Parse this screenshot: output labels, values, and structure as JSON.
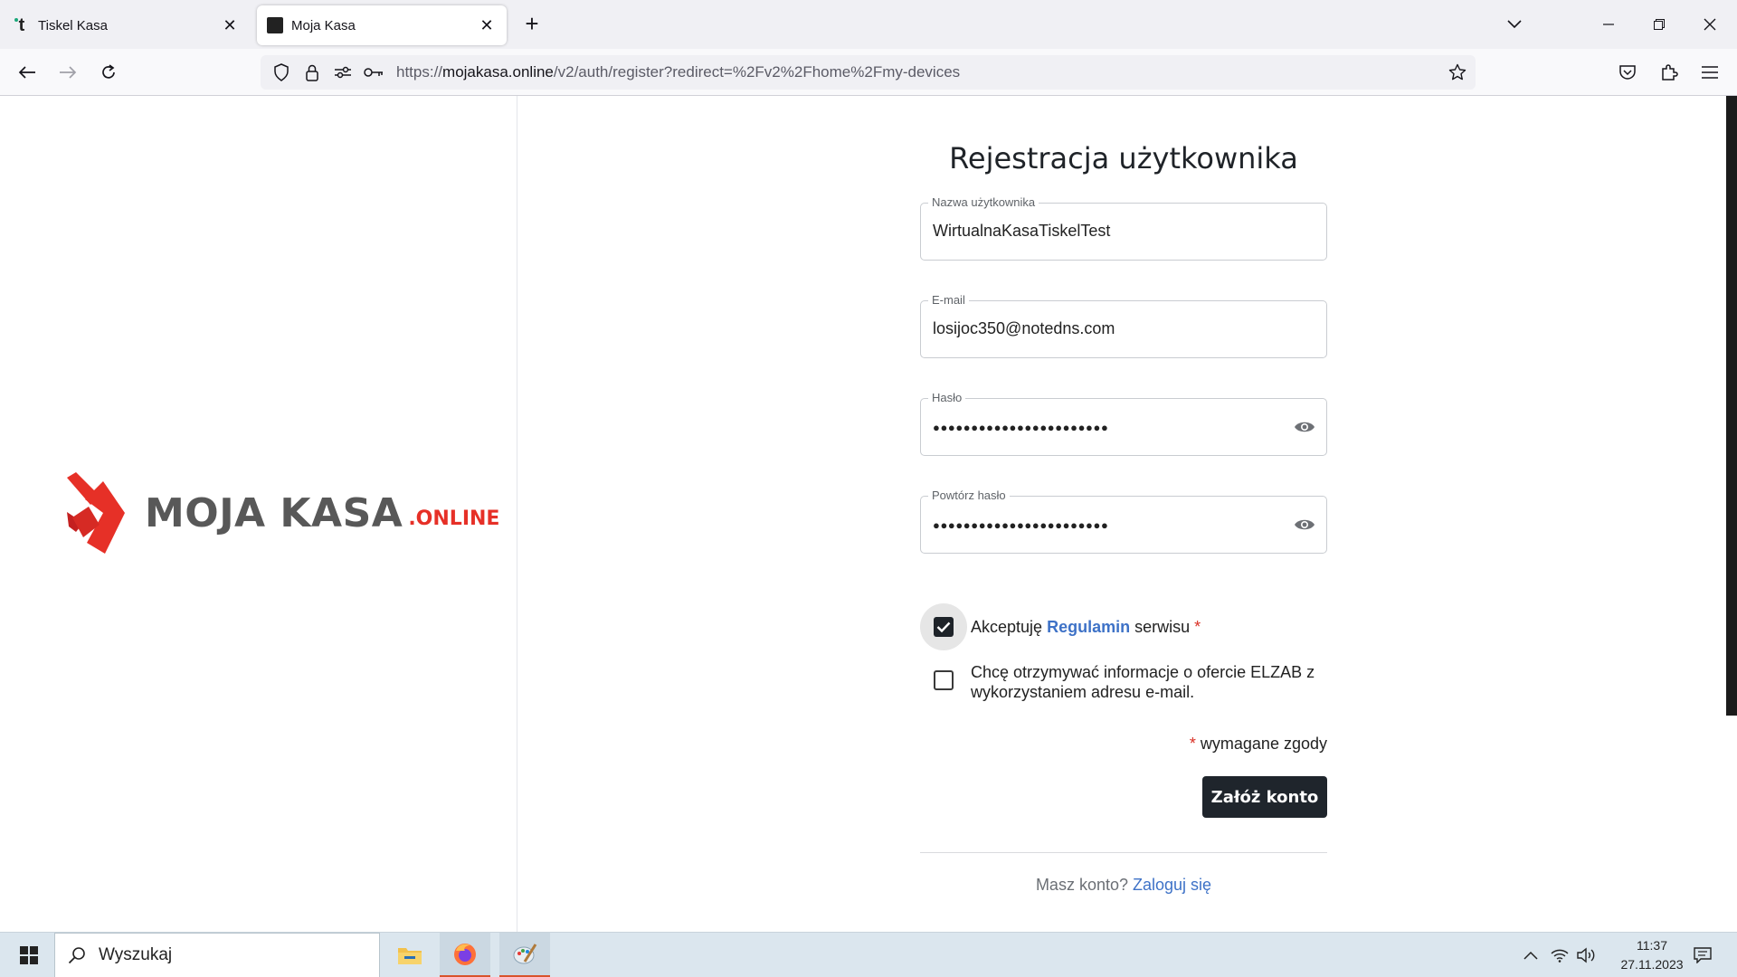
{
  "browser": {
    "tabs": [
      {
        "label": "Tiskel Kasa",
        "active": false
      },
      {
        "label": "Moja Kasa",
        "active": true
      }
    ],
    "url_prefix": "https://",
    "url_domain": "mojakasa.online",
    "url_path": "/v2/auth/register?redirect=%2Fv2%2Fhome%2Fmy-devices"
  },
  "logo": {
    "text": "MOJA KASA",
    "suffix": ".ONLINE",
    "accent_color": "#e63027"
  },
  "form": {
    "title": "Rejestracja użytkownika",
    "username": {
      "label": "Nazwa użytkownika",
      "value": "WirtualnaKasaTiskelTest"
    },
    "email": {
      "label": "E-mail",
      "value": "losijoc350@notedns.com"
    },
    "password": {
      "label": "Hasło",
      "masked": "●●●●●●●●●●●●●●●●●●●●●●●"
    },
    "password_repeat": {
      "label": "Powtórz hasło",
      "masked": "●●●●●●●●●●●●●●●●●●●●●●●"
    },
    "terms": {
      "prefix": "Akceptuję",
      "link": "Regulamin",
      "suffix": "serwisu",
      "required_mark": "*",
      "checked": true
    },
    "marketing": {
      "text": "Chcę otrzymywać informacje o ofercie ELZAB z wykorzystaniem adresu e-mail.",
      "checked": false
    },
    "required_note_mark": "*",
    "required_note": "wymagane zgody",
    "submit_label": "Załóż konto",
    "login_prompt": "Masz konto?",
    "login_link": "Zaloguj się",
    "link_color": "#3e72c7"
  },
  "taskbar": {
    "search_placeholder": "Wyszukaj",
    "time": "11:37",
    "date": "27.11.2023"
  }
}
